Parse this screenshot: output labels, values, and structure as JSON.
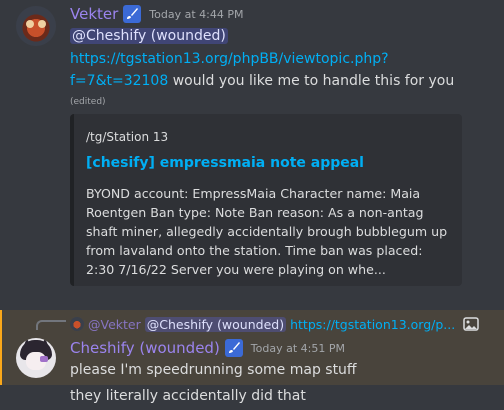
{
  "message1": {
    "author": "Vekter",
    "author_color": "#9b84ee",
    "role_icon": "paintbrush-icon",
    "timestamp": "Today at 4:44 PM",
    "mention": "@Cheshify (wounded)",
    "link_line1": "https://tgstation13.org/phpBB/viewtopic.php?",
    "link_line2": "f=7&t=32108",
    "text_after_link": " would you like me to handle this for you",
    "edited": "(edited)",
    "embed": {
      "provider": "/tg/Station 13",
      "title": "[chesify] empressmaia note appeal",
      "description": "BYOND account: EmpressMaia Character name: Maia Roentgen Ban type: Note Ban reason: As a non-antag shaft miner, allegedly accidentally brough bubblegum up from lavaland onto the station. Time ban was placed: 2:30 7/16/22 Server you were playing on whe..."
    }
  },
  "message2": {
    "highlight_color": "#faa81a",
    "reply": {
      "author": "@Vekter",
      "mention": "@Cheshify (wounded)",
      "link": "https://tgstation13.org/p...",
      "attachment_icon": "image-icon"
    },
    "author": "Cheshify (wounded)",
    "author_color": "#9b84ee",
    "role_icon": "paintbrush-icon",
    "timestamp": "Today at 4:51 PM",
    "text": "please I'm speedrunning some map stuff"
  },
  "message3": {
    "text": "they literally accidentally did that"
  },
  "colors": {
    "background": "#36393f",
    "link": "#00aff4",
    "embed_background": "#2f3136"
  }
}
